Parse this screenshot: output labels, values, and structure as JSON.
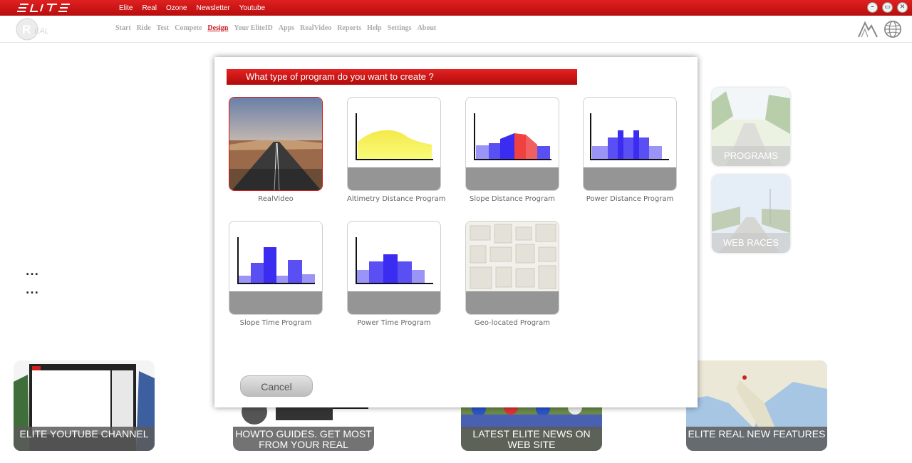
{
  "topbar": {
    "nav": [
      "Elite",
      "Real",
      "Ozone",
      "Newsletter",
      "Youtube"
    ],
    "window_buttons": [
      {
        "icon": "minimize-icon",
        "glyph": "–"
      },
      {
        "icon": "maximize-icon",
        "glyph": "▭"
      },
      {
        "icon": "close-icon",
        "glyph": "✕"
      }
    ]
  },
  "mainnav": {
    "items": [
      "Start",
      "Ride",
      "Test",
      "Compete",
      "Design",
      "Your EliteID",
      "Apps",
      "RealVideo",
      "Reports",
      "Help",
      "Settings",
      "About"
    ],
    "active": "Design"
  },
  "side_thumbs": [
    {
      "label": "PROGRAMS"
    },
    {
      "label": "WEB RACES"
    }
  ],
  "dots": [
    "...",
    "..."
  ],
  "bottom_cards": [
    {
      "label": "ELITE YOUTUBE CHANNEL"
    },
    {
      "label": "HOWTO GUIDES. GET MOST FROM YOUR REAL"
    },
    {
      "label": "LATEST ELITE NEWS ON WEB SITE"
    },
    {
      "label": "ELITE REAL NEW FEATURES"
    }
  ],
  "dialog": {
    "title": "What type of program do you want to create ?",
    "cancel_label": "Cancel",
    "tiles": [
      {
        "label": "RealVideo",
        "selected": true
      },
      {
        "label": "Altimetry Distance Program"
      },
      {
        "label": "Slope Distance Program"
      },
      {
        "label": "Power Distance Program"
      },
      {
        "label": "Slope Time Program"
      },
      {
        "label": "Power Time Program"
      },
      {
        "label": "Geo-located Program"
      }
    ]
  },
  "colors": {
    "brand_red": "#c8171e",
    "bar_blue": "#3a2cf0",
    "bar_light_blue": "#9a94f6",
    "bar_red": "#f04040",
    "altimetry_yellow": "#f4f24a"
  }
}
